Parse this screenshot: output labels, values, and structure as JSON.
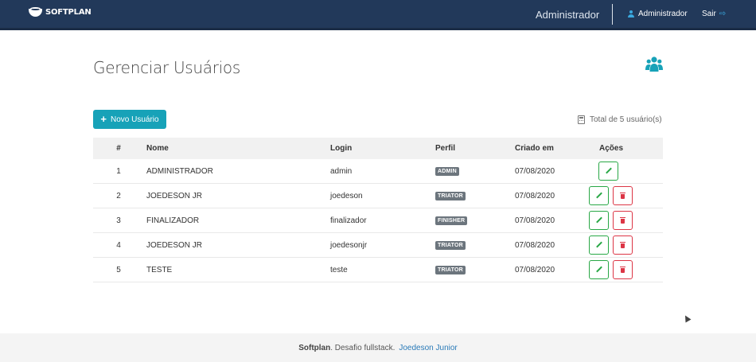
{
  "navbar": {
    "brand": "SOFTPLAN",
    "role": "Administrador",
    "user": "Administrador",
    "logout": "Sair"
  },
  "page": {
    "title": "Gerenciar Usuários",
    "new_button": "Novo Usuário",
    "total": "Total de 5 usuário(s)"
  },
  "table": {
    "headers": {
      "num": "#",
      "name": "Nome",
      "login": "Login",
      "perfil": "Perfil",
      "date": "Criado em",
      "actions": "Ações"
    },
    "rows": [
      {
        "num": "1",
        "name": "ADMINISTRADOR",
        "login": "admin",
        "perfil": "ADMIN",
        "date": "07/08/2020",
        "deletable": false
      },
      {
        "num": "2",
        "name": "JOEDESON JR",
        "login": "joedeson",
        "perfil": "TRIATOR",
        "date": "07/08/2020",
        "deletable": true
      },
      {
        "num": "3",
        "name": "FINALIZADOR",
        "login": "finalizador",
        "perfil": "FINISHER",
        "date": "07/08/2020",
        "deletable": true
      },
      {
        "num": "4",
        "name": "JOEDESON JR",
        "login": "joedesonjr",
        "perfil": "TRIATOR",
        "date": "07/08/2020",
        "deletable": true
      },
      {
        "num": "5",
        "name": "TESTE",
        "login": "teste",
        "perfil": "TRIATOR",
        "date": "07/08/2020",
        "deletable": true
      }
    ]
  },
  "footer": {
    "company": "Softplan",
    "text": ". Desafio fullstack.",
    "author": "Joedeson Junior"
  },
  "colors": {
    "navbar": "#22395a",
    "accent": "#17a2b8",
    "edit": "#28a745",
    "delete": "#dc3545"
  }
}
